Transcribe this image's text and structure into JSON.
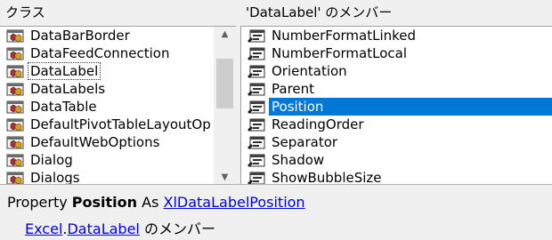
{
  "classes_pane": {
    "header": "クラス",
    "items": [
      {
        "label": "DataBarBorder",
        "icon": "class-module-icon"
      },
      {
        "label": "DataFeedConnection",
        "icon": "class-module-icon"
      },
      {
        "label": "DataLabel",
        "icon": "class-module-icon",
        "focused": true
      },
      {
        "label": "DataLabels",
        "icon": "class-module-icon"
      },
      {
        "label": "DataTable",
        "icon": "class-module-icon"
      },
      {
        "label": "DefaultPivotTableLayoutOp",
        "icon": "class-module-icon"
      },
      {
        "label": "DefaultWebOptions",
        "icon": "class-module-icon"
      },
      {
        "label": "Dialog",
        "icon": "class-module-icon"
      },
      {
        "label": "Dialogs",
        "icon": "class-module-icon"
      }
    ],
    "scroll": {
      "up_icon": "scroll-up-arrow-icon",
      "down_icon": "scroll-down-arrow-icon"
    }
  },
  "members_pane": {
    "header": "'DataLabel' のメンバー",
    "items": [
      {
        "label": "NumberFormatLinked",
        "icon": "property-icon"
      },
      {
        "label": "NumberFormatLocal",
        "icon": "property-icon"
      },
      {
        "label": "Orientation",
        "icon": "property-icon"
      },
      {
        "label": "Parent",
        "icon": "property-icon"
      },
      {
        "label": "Position",
        "icon": "property-icon",
        "selected": true
      },
      {
        "label": "ReadingOrder",
        "icon": "property-icon"
      },
      {
        "label": "Separator",
        "icon": "property-icon"
      },
      {
        "label": "Shadow",
        "icon": "property-icon"
      },
      {
        "label": "ShowBubbleSize",
        "icon": "property-icon"
      }
    ]
  },
  "details": {
    "kind_prefix": "Property ",
    "member_name": "Position",
    "as_text": " As ",
    "type_link": "XlDataLabelPosition",
    "library_link": "Excel",
    "dot": ".",
    "class_link": "DataLabel",
    "member_of_suffix": " のメンバー"
  },
  "colors": {
    "selection": "#0078d7",
    "link": "#0000e0",
    "background": "#f0f0f0"
  }
}
